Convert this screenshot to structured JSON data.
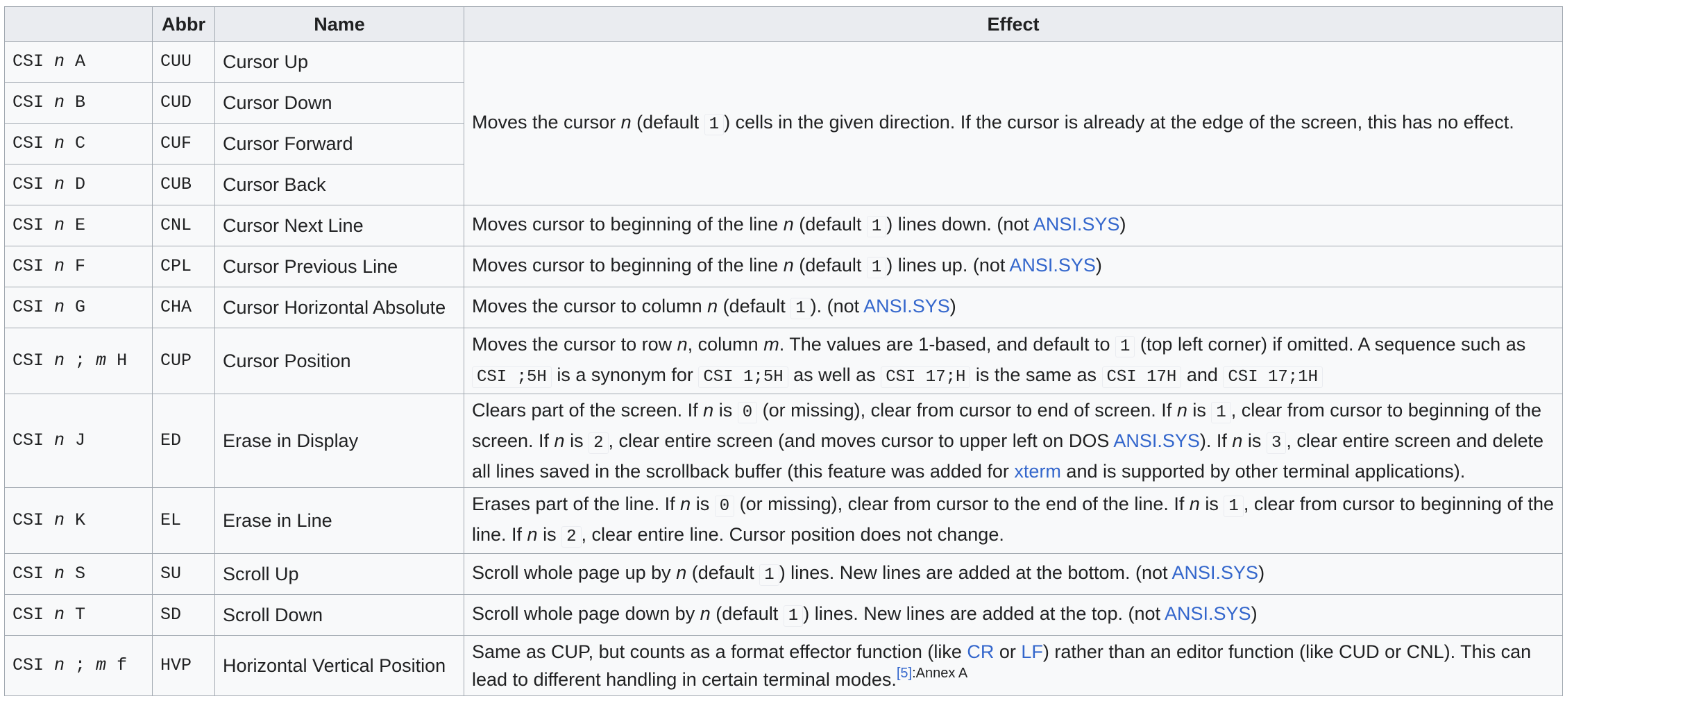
{
  "headers": {
    "code": "",
    "abbr": "Abbr",
    "name": "Name",
    "effect": "Effect"
  },
  "rows": [
    {
      "seq_prefix": "CSI ",
      "p1": "n",
      "seq_mid": "",
      "p2": "",
      "seq_suffix": " A",
      "abbr": "CUU",
      "name": "Cursor Up"
    },
    {
      "seq_prefix": "CSI ",
      "p1": "n",
      "seq_suffix": " B",
      "abbr": "CUD",
      "name": "Cursor Down"
    },
    {
      "seq_prefix": "CSI ",
      "p1": "n",
      "seq_suffix": " C",
      "abbr": "CUF",
      "name": "Cursor Forward"
    },
    {
      "seq_prefix": "CSI ",
      "p1": "n",
      "seq_suffix": " D",
      "abbr": "CUB",
      "name": "Cursor Back"
    },
    {
      "seq_prefix": "CSI ",
      "p1": "n",
      "seq_suffix": " E",
      "abbr": "CNL",
      "name": "Cursor Next Line"
    },
    {
      "seq_prefix": "CSI ",
      "p1": "n",
      "seq_suffix": " F",
      "abbr": "CPL",
      "name": "Cursor Previous Line"
    },
    {
      "seq_prefix": "CSI ",
      "p1": "n",
      "seq_suffix": " G",
      "abbr": "CHA",
      "name": "Cursor Horizontal Absolute"
    },
    {
      "seq_prefix": "CSI ",
      "p1": "n",
      "seq_mid": " ; ",
      "p2": "m",
      "seq_suffix": " H",
      "abbr": "CUP",
      "name": "Cursor Position"
    },
    {
      "seq_prefix": "CSI ",
      "p1": "n",
      "seq_suffix": " J",
      "abbr": "ED",
      "name": "Erase in Display"
    },
    {
      "seq_prefix": "CSI ",
      "p1": "n",
      "seq_suffix": " K",
      "abbr": "EL",
      "name": "Erase in Line"
    },
    {
      "seq_prefix": "CSI ",
      "p1": "n",
      "seq_suffix": " S",
      "abbr": "SU",
      "name": "Scroll Up"
    },
    {
      "seq_prefix": "CSI ",
      "p1": "n",
      "seq_suffix": " T",
      "abbr": "SD",
      "name": "Scroll Down"
    },
    {
      "seq_prefix": "CSI ",
      "p1": "n",
      "seq_mid": " ; ",
      "p2": "m",
      "seq_suffix": " f",
      "abbr": "HVP",
      "name": "Horizontal Vertical Position"
    }
  ],
  "effects": {
    "cursor_move": {
      "t1": "Moves the cursor ",
      "n": "n",
      "t2": " (default ",
      "k1": "1",
      "t3": ") cells in the given direction. If the cursor is already at the edge of the screen, this has no effect."
    },
    "cnl": {
      "t1": "Moves cursor to beginning of the line ",
      "n": "n",
      "t2": " (default ",
      "k1": "1",
      "t3": ") lines down. (not ",
      "link": "ANSI.SYS",
      "t4": ")"
    },
    "cpl": {
      "t1": "Moves cursor to beginning of the line ",
      "n": "n",
      "t2": " (default ",
      "k1": "1",
      "t3": ") lines up. (not ",
      "link": "ANSI.SYS",
      "t4": ")"
    },
    "cha": {
      "t1": "Moves the cursor to column ",
      "n": "n",
      "t2": " (default ",
      "k1": "1",
      "t3": "). (not ",
      "link": "ANSI.SYS",
      "t4": ")"
    },
    "cup": {
      "t1": "Moves the cursor to row ",
      "n": "n",
      "t2": ", column ",
      "m": "m",
      "t3": ". The values are 1-based, and default to ",
      "k1": "1",
      "t4": " (top left corner) if omitted. A sequence such as ",
      "k2": "CSI ;5H",
      "t5": " is a synonym for ",
      "k3": "CSI 1;5H",
      "t6": " as well as ",
      "k4": "CSI 17;H",
      "t7": " is the same as ",
      "k5": "CSI 17H",
      "t8": " and ",
      "k6": "CSI 17;1H"
    },
    "ed": {
      "t1": "Clears part of the screen. If ",
      "n1": "n",
      "t2": " is ",
      "k1": "0",
      "t3": " (or missing), clear from cursor to end of screen. If ",
      "n2": "n",
      "t4": " is ",
      "k2": "1",
      "t5": ", clear from cursor to beginning of the screen. If ",
      "n3": "n",
      "t6": " is ",
      "k3": "2",
      "t7": ", clear entire screen (and moves cursor to upper left on DOS ",
      "link1": "ANSI.SYS",
      "t8": "). If ",
      "n4": "n",
      "t9": " is ",
      "k4": "3",
      "t10": ", clear entire screen and delete all lines saved in the scrollback buffer (this feature was added for ",
      "link2": "xterm",
      "t11": " and is supported by other terminal applications)."
    },
    "el": {
      "t1": "Erases part of the line. If ",
      "n1": "n",
      "t2": " is ",
      "k1": "0",
      "t3": " (or missing), clear from cursor to the end of the line. If ",
      "n2": "n",
      "t4": " is ",
      "k2": "1",
      "t5": ", clear from cursor to beginning of the line. If ",
      "n3": "n",
      "t6": " is ",
      "k3": "2",
      "t7": ", clear entire line. Cursor position does not change."
    },
    "su": {
      "t1": "Scroll whole page up by ",
      "n": "n",
      "t2": " (default ",
      "k1": "1",
      "t3": ") lines. New lines are added at the bottom. (not ",
      "link": "ANSI.SYS",
      "t4": ")"
    },
    "sd": {
      "t1": "Scroll whole page down by ",
      "n": "n",
      "t2": " (default ",
      "k1": "1",
      "t3": ") lines. New lines are added at the top. (not ",
      "link": "ANSI.SYS",
      "t4": ")"
    },
    "hvp": {
      "t1": "Same as CUP, but counts as a format effector function (like ",
      "link1": "CR",
      "t2": " or ",
      "link2": "LF",
      "t3": ") rather than an editor function (like CUD or CNL). This can lead to different handling in certain terminal modes.",
      "ref": "[5]",
      "ref_suffix": ":Annex A"
    }
  },
  "colors": {
    "header_bg": "#eaecf0",
    "cell_bg": "#f8f9fa",
    "border": "#a2a9b1",
    "link": "#3366cc",
    "text": "#202122"
  }
}
